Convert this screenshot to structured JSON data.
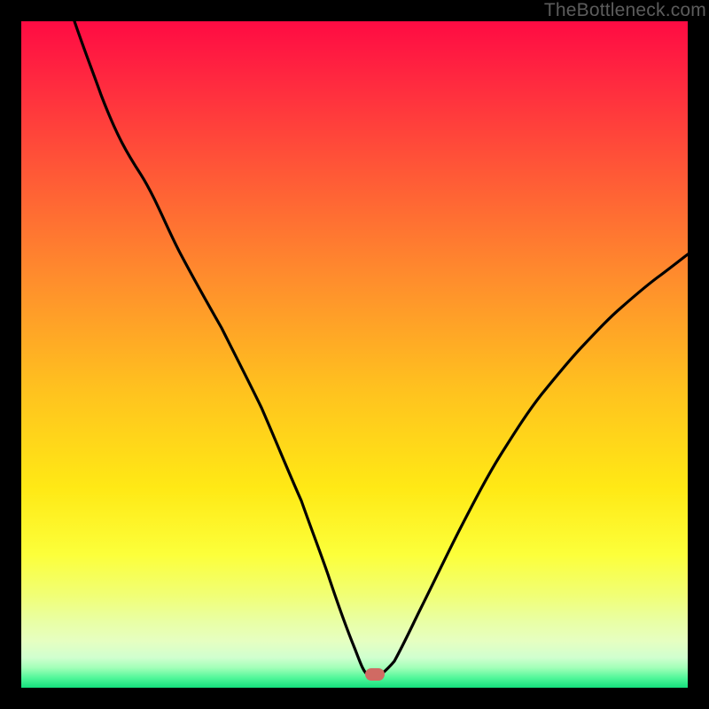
{
  "watermark": "TheBottleneck.com",
  "marker": {
    "x_pct": 53.1,
    "y_pct": 98.0
  },
  "chart_data": {
    "type": "line",
    "title": "",
    "xlabel": "",
    "ylabel": "",
    "xlim": [
      0,
      100
    ],
    "ylim": [
      0,
      100
    ],
    "grid": false,
    "legend": false,
    "background_gradient": {
      "direction": "vertical",
      "stops": [
        {
          "pos": 0,
          "color": "#ff0b43"
        },
        {
          "pos": 0.38,
          "color": "#ff8b2d"
        },
        {
          "pos": 0.7,
          "color": "#ffe915"
        },
        {
          "pos": 0.9,
          "color": "#e9ffa4"
        },
        {
          "pos": 1.0,
          "color": "#14de7c"
        }
      ]
    },
    "series": [
      {
        "name": "bottleneck-curve",
        "type": "line",
        "color": "#000000",
        "x": [
          8,
          12,
          18,
          24,
          30,
          36,
          42,
          46,
          50,
          52,
          54,
          56,
          60,
          66,
          72,
          78,
          84,
          90,
          96,
          100
        ],
        "y": [
          100,
          89,
          77,
          65,
          54,
          42,
          28,
          17,
          6,
          2,
          2,
          4,
          12,
          24,
          35,
          44,
          51,
          57,
          62,
          65
        ]
      }
    ],
    "marker_point": {
      "x": 53,
      "y": 2,
      "color": "#d06a63"
    }
  }
}
